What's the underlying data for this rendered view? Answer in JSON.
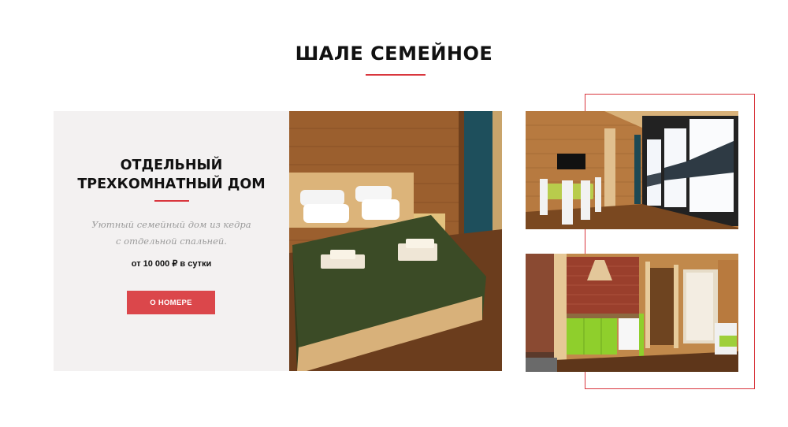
{
  "section": {
    "title": "ШАЛЕ СЕМЕЙНОЕ"
  },
  "card": {
    "title_line1": "ОТДЕЛЬНЫЙ",
    "title_line2": "ТРЕХКОМНАТНЫЙ ДОМ",
    "desc_line1": "Уютный семейный дом из кедра",
    "desc_line2": "с отдельной спальней.",
    "price": "от 10 000 ₽ в сутки",
    "button_label": "О НОМЕРЕ"
  },
  "colors": {
    "accent": "#d9363e",
    "button": "#db474b",
    "panel": "#f3f1f1"
  }
}
